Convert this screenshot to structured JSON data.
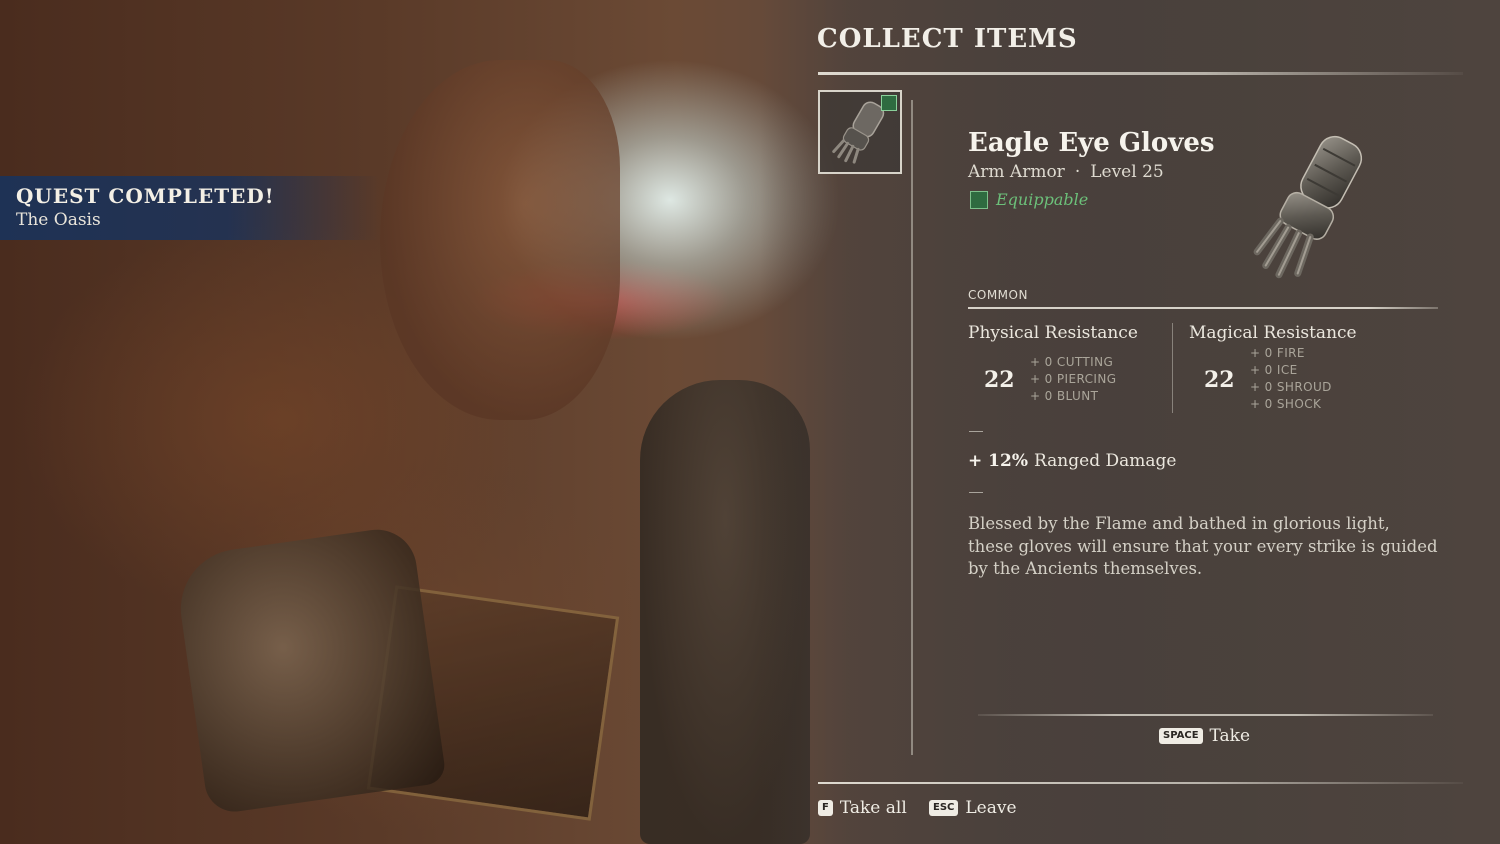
{
  "quest": {
    "title": "QUEST COMPLETED!",
    "subtitle": "The Oasis"
  },
  "panel": {
    "title": "COLLECT ITEMS",
    "slot_icon": "gauntlet-icon",
    "slot_badge_icon": "equippable-badge-icon"
  },
  "item": {
    "name": "Eagle Eye Gloves",
    "type": "Arm Armor",
    "separator": "·",
    "level": "Level 25",
    "equippable": "Equippable",
    "rarity": "COMMON",
    "image_icon": "gauntlet-icon",
    "physical": {
      "label": "Physical Resistance",
      "value": "22",
      "subs": [
        "+ 0 CUTTING",
        "+ 0 PIERCING",
        "+ 0 BLUNT"
      ]
    },
    "magical": {
      "label": "Magical Resistance",
      "value": "22",
      "subs": [
        "+ 0 FIRE",
        "+ 0 ICE",
        "+ 0 SHROUD",
        "+ 0 SHOCK"
      ]
    },
    "bonus": {
      "value": "+ 12%",
      "label": "Ranged Damage"
    },
    "description": "Blessed by the Flame and bathed in glorious light, these gloves will ensure that your every strike is guided by the Ancients themselves."
  },
  "actions": {
    "take": {
      "key": "SPACE",
      "label": "Take"
    },
    "take_all": {
      "key": "F",
      "label": "Take all"
    },
    "leave": {
      "key": "ESC",
      "label": "Leave"
    }
  },
  "colors": {
    "quest_banner": "#1c3258",
    "equippable_green": "#6cc07a"
  }
}
